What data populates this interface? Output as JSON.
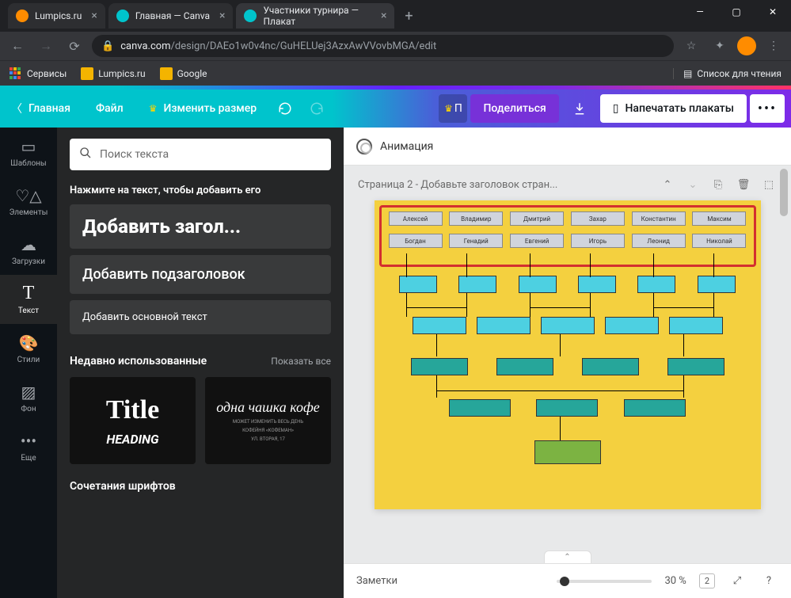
{
  "browser": {
    "tabs": [
      {
        "title": "Lumpics.ru",
        "favicon": "#ff8c00"
      },
      {
        "title": "Главная — Canva",
        "favicon": "#00c4cc"
      },
      {
        "title": "Участники турнира — Плакат",
        "favicon": "#00c4cc",
        "active": true
      }
    ],
    "url_domain": "canva.com",
    "url_path": "/design/DAEo1w0v4nc/GuHELUej3AzxAwVVovbMGA/edit",
    "bookmarks": [
      "Сервисы",
      "Lumpics.ru",
      "Google"
    ],
    "reading_list": "Список для чтения"
  },
  "canva_top": {
    "home": "Главная",
    "file": "Файл",
    "resize": "Изменить размер",
    "pro_badge": "П",
    "share": "Поделиться",
    "print": "Напечатать плакаты"
  },
  "rail": [
    {
      "id": "templates",
      "label": "Шаблоны"
    },
    {
      "id": "elements",
      "label": "Элементы"
    },
    {
      "id": "uploads",
      "label": "Загрузки"
    },
    {
      "id": "text",
      "label": "Текст",
      "active": true
    },
    {
      "id": "styles",
      "label": "Стили"
    },
    {
      "id": "background",
      "label": "Фон"
    },
    {
      "id": "more",
      "label": "Еще"
    }
  ],
  "panel": {
    "search_placeholder": "Поиск текста",
    "hint": "Нажмите на текст, чтобы добавить его",
    "add_heading": "Добавить загол...",
    "add_subheading": "Добавить подзаголовок",
    "add_body": "Добавить основной текст",
    "recent_title": "Недавно использованные",
    "show_all": "Показать все",
    "recent1_title": "Title",
    "recent1_heading": "HEADING",
    "recent2_script": "одна чашка кофе",
    "recent2_small1": "МОЖЕТ ИЗМЕНИТЬ ВЕСЬ ДЕНЬ",
    "recent2_small2": "КОФЕЙНЯ «КОФЕМАН»",
    "recent2_small3": "УЛ. ВТОРАЯ, 17",
    "combos_title": "Сочетания шрифтов"
  },
  "canvas": {
    "toolbar_anim": "Анимация",
    "page_title": "Страница 2 - Добавьте заголовок стран...",
    "participants_row1": [
      "Алексей",
      "Владимир",
      "Дмитрий",
      "Захар",
      "Константин",
      "Максим"
    ],
    "participants_row2": [
      "Богдан",
      "Генадий",
      "Евгений",
      "Игорь",
      "Леонид",
      "Николай"
    ]
  },
  "bottom": {
    "notes": "Заметки",
    "zoom": "30 %",
    "pages": "2"
  }
}
